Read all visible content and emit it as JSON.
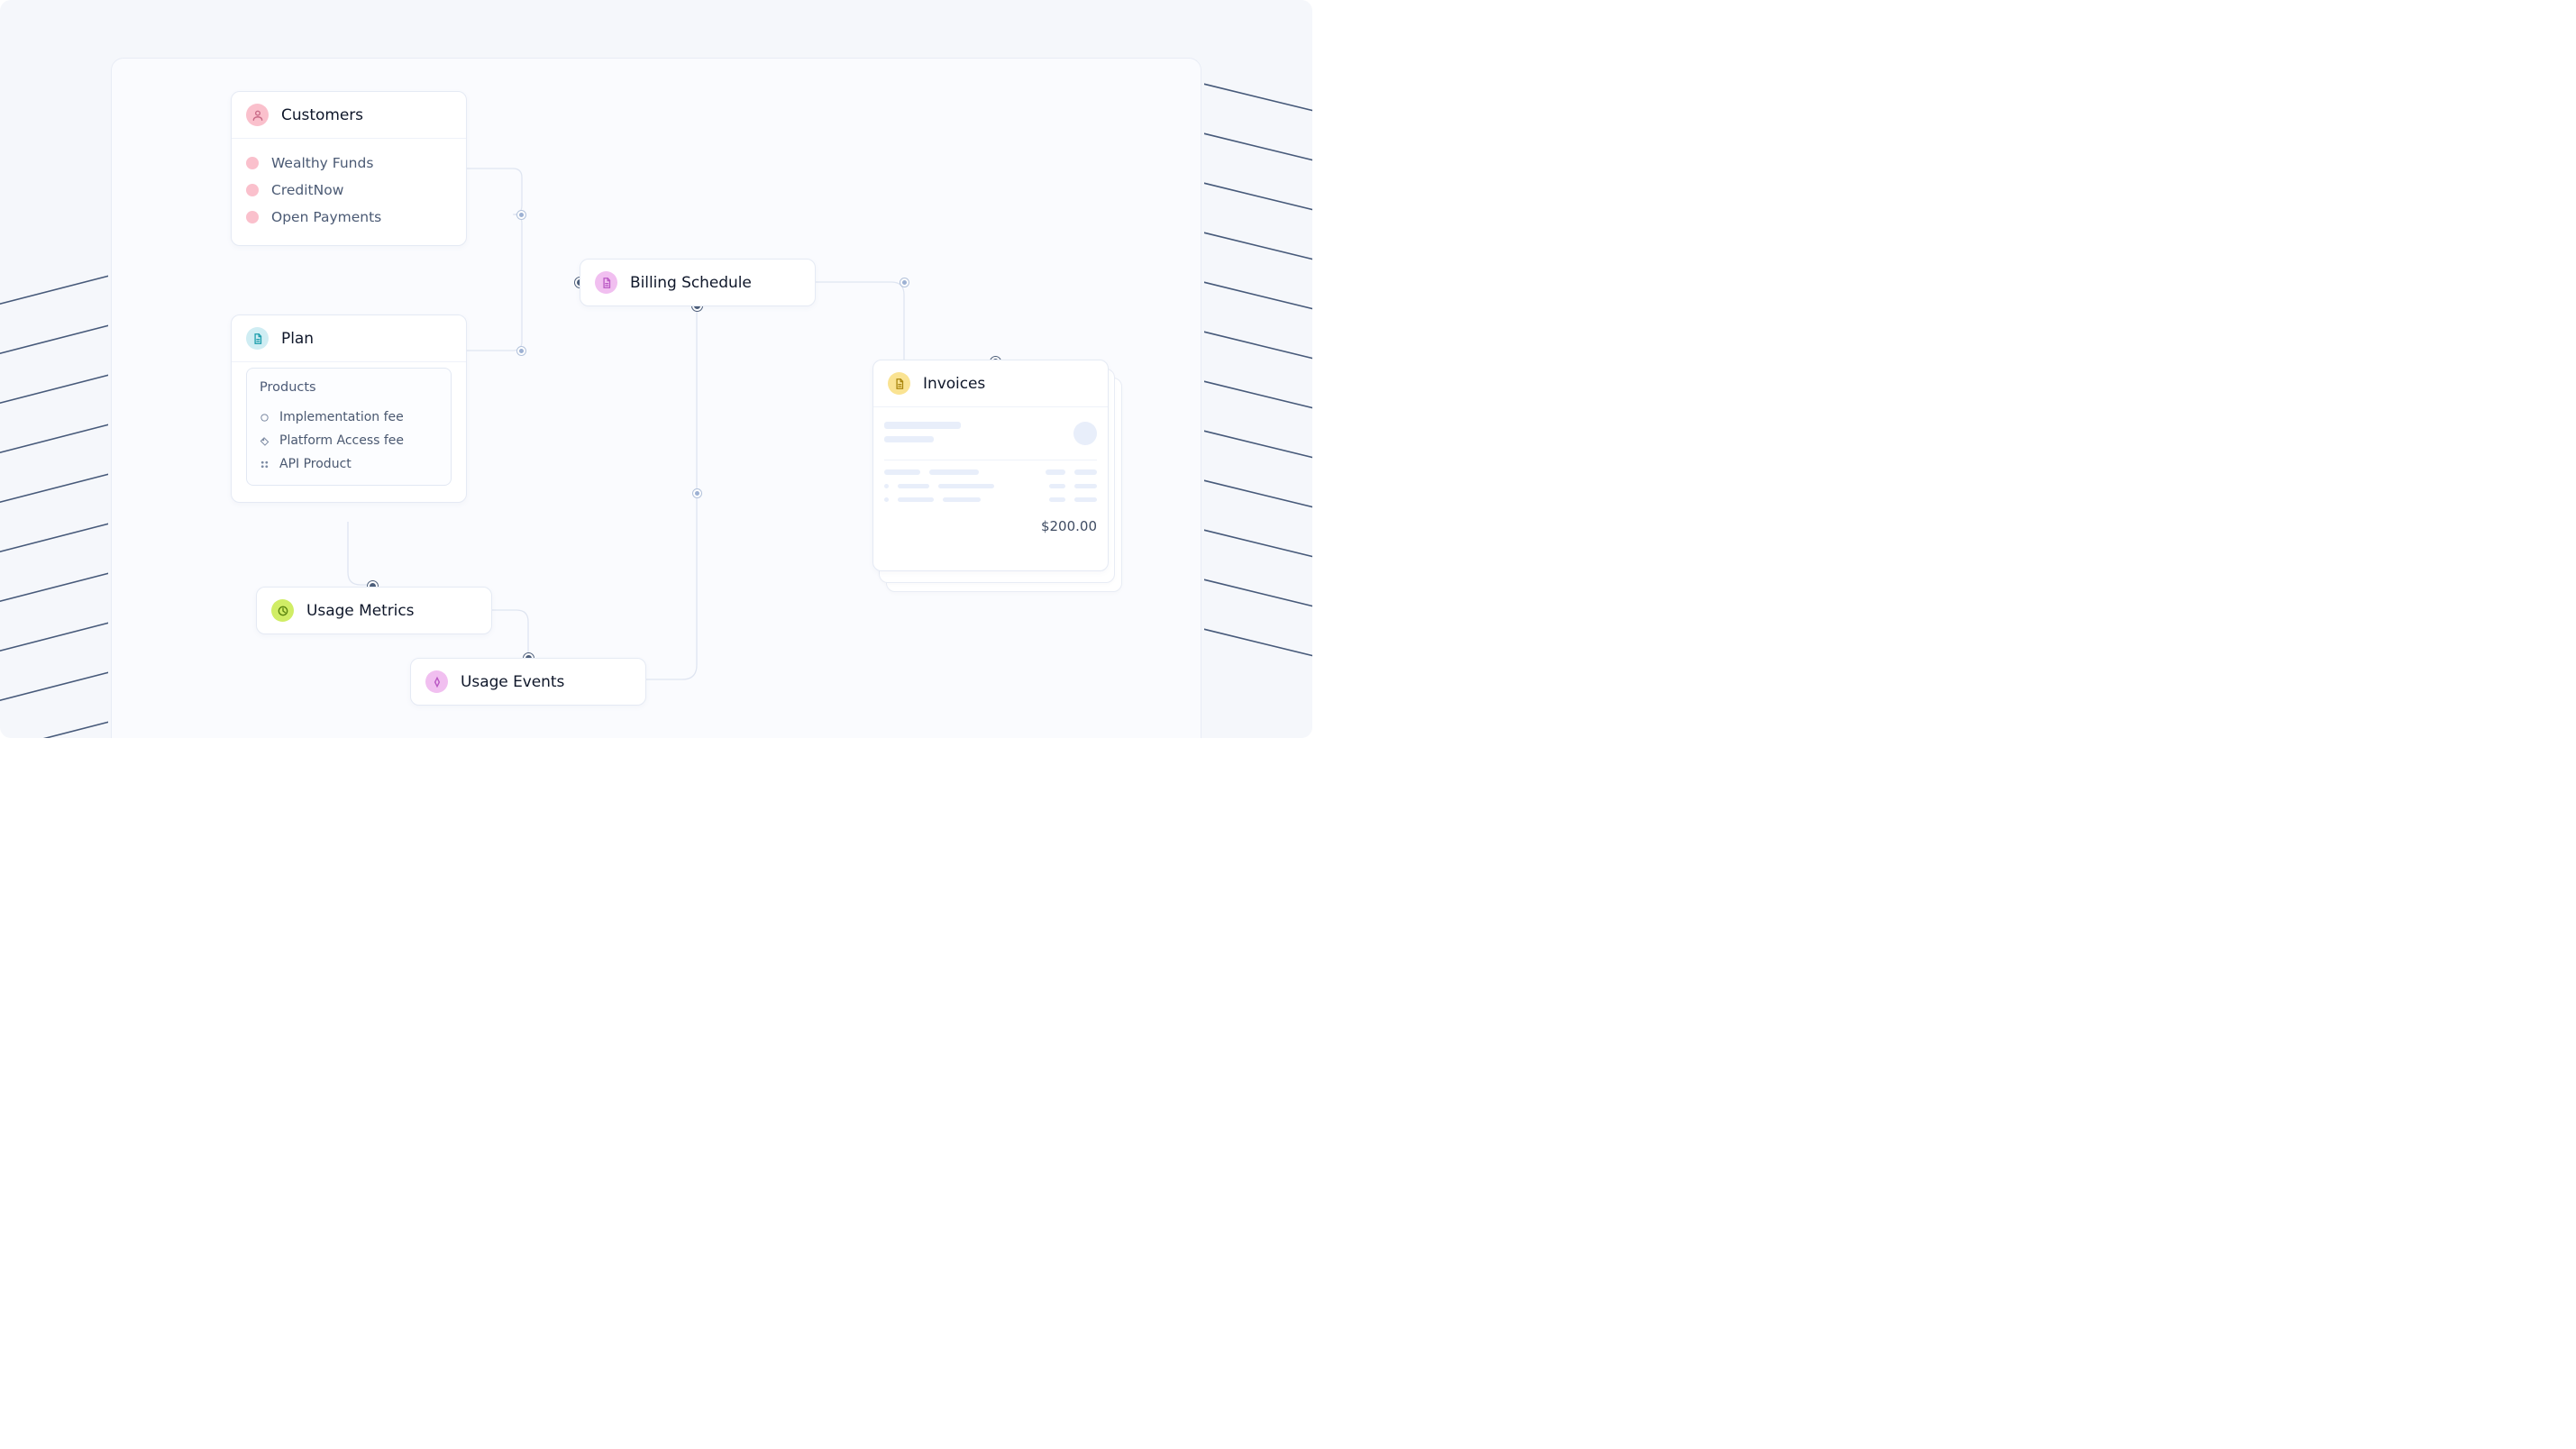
{
  "customers": {
    "title": "Customers",
    "items": [
      "Wealthy Funds",
      "CreditNow",
      "Open Payments"
    ]
  },
  "plan": {
    "title": "Plan",
    "products_label": "Products",
    "products": [
      "Implementation fee",
      "Platform Access fee",
      "API Product"
    ]
  },
  "usage_metrics": {
    "title": "Usage Metrics"
  },
  "usage_events": {
    "title": "Usage Events"
  },
  "billing": {
    "title": "Billing Schedule"
  },
  "invoices": {
    "title": "Invoices",
    "total": "$200.00"
  }
}
